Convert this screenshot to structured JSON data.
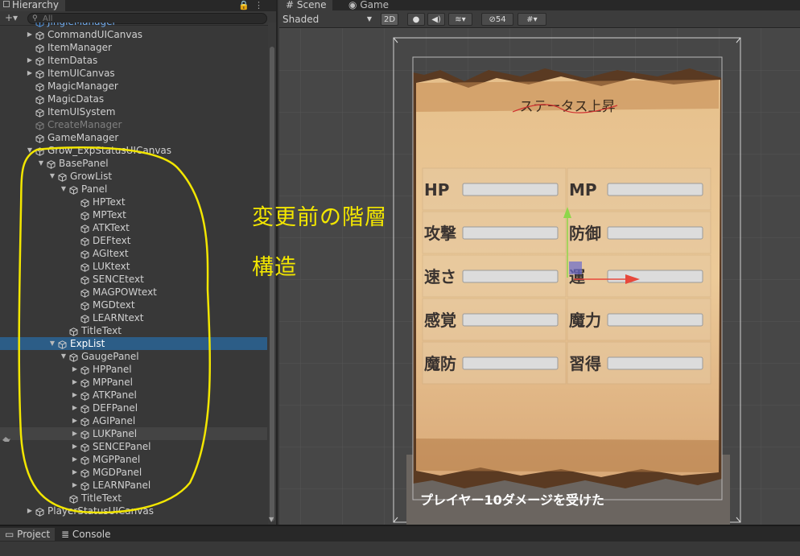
{
  "hierarchy": {
    "tab_label": "Hierarchy",
    "search_placeholder": "All",
    "items": [
      {
        "label": "JingleManager",
        "depth": 0,
        "arrow": "",
        "style": "blue"
      },
      {
        "label": "CommandUICanvas",
        "depth": 0,
        "arrow": "right"
      },
      {
        "label": "ItemManager",
        "depth": 0,
        "arrow": ""
      },
      {
        "label": "ItemDatas",
        "depth": 0,
        "arrow": "right"
      },
      {
        "label": "ItemUICanvas",
        "depth": 0,
        "arrow": "right"
      },
      {
        "label": "MagicManager",
        "depth": 0,
        "arrow": ""
      },
      {
        "label": "MagicDatas",
        "depth": 0,
        "arrow": ""
      },
      {
        "label": "ItemUISystem",
        "depth": 0,
        "arrow": ""
      },
      {
        "label": "CreateManager",
        "depth": 0,
        "arrow": "",
        "style": "dim"
      },
      {
        "label": "GameManager",
        "depth": 0,
        "arrow": ""
      },
      {
        "label": "Grow_ExpStatusUICanvas",
        "depth": 0,
        "arrow": "down"
      },
      {
        "label": "BasePanel",
        "depth": 1,
        "arrow": "down"
      },
      {
        "label": "GrowList",
        "depth": 2,
        "arrow": "down"
      },
      {
        "label": "Panel",
        "depth": 3,
        "arrow": "down"
      },
      {
        "label": "HPText",
        "depth": 4,
        "arrow": ""
      },
      {
        "label": "MPText",
        "depth": 4,
        "arrow": ""
      },
      {
        "label": "ATKText",
        "depth": 4,
        "arrow": ""
      },
      {
        "label": "DEFtext",
        "depth": 4,
        "arrow": ""
      },
      {
        "label": "AGItext",
        "depth": 4,
        "arrow": ""
      },
      {
        "label": "LUKtext",
        "depth": 4,
        "arrow": ""
      },
      {
        "label": "SENCEtext",
        "depth": 4,
        "arrow": ""
      },
      {
        "label": "MAGPOWtext",
        "depth": 4,
        "arrow": ""
      },
      {
        "label": "MGDtext",
        "depth": 4,
        "arrow": ""
      },
      {
        "label": "LEARNtext",
        "depth": 4,
        "arrow": ""
      },
      {
        "label": "TitleText",
        "depth": 3,
        "arrow": ""
      },
      {
        "label": "ExpList",
        "depth": 2,
        "arrow": "down",
        "style": "sel"
      },
      {
        "label": "GaugePanel",
        "depth": 3,
        "arrow": "down"
      },
      {
        "label": "HPPanel",
        "depth": 4,
        "arrow": "right"
      },
      {
        "label": "MPPanel",
        "depth": 4,
        "arrow": "right"
      },
      {
        "label": "ATKPanel",
        "depth": 4,
        "arrow": "right"
      },
      {
        "label": "DEFPanel",
        "depth": 4,
        "arrow": "right"
      },
      {
        "label": "AGIPanel",
        "depth": 4,
        "arrow": "right"
      },
      {
        "label": "LUKPanel",
        "depth": 4,
        "arrow": "right",
        "style": "hov"
      },
      {
        "label": "SENCEPanel",
        "depth": 4,
        "arrow": "right"
      },
      {
        "label": "MGPPanel",
        "depth": 4,
        "arrow": "right"
      },
      {
        "label": "MGDPanel",
        "depth": 4,
        "arrow": "right"
      },
      {
        "label": "LEARNPanel",
        "depth": 4,
        "arrow": "right"
      },
      {
        "label": "TitleText",
        "depth": 3,
        "arrow": ""
      },
      {
        "label": "PlayerStatusUICanvas",
        "depth": 0,
        "arrow": "right"
      }
    ]
  },
  "scene": {
    "tab_scene": "Scene",
    "tab_game": "Game",
    "shading_mode": "Shaded",
    "btn_2d": "2D",
    "hidden_count": "54",
    "panel_title": "ステータス上昇",
    "rows": [
      [
        "HP",
        "MP"
      ],
      [
        "攻撃",
        "防御"
      ],
      [
        "速さ",
        "運"
      ],
      [
        "感覚",
        "魔力"
      ],
      [
        "魔防",
        "習得"
      ]
    ],
    "message": "プレイヤー10ダメージを受けた"
  },
  "annotation": {
    "line1": "変更前の階層",
    "line2": "構造",
    "color": "#f2e600"
  },
  "bottom": {
    "tab_project": "Project",
    "tab_console": "Console"
  },
  "colors": {
    "selection": "#2c5d87",
    "panel_bg": "#383838",
    "scene_bg": "#474747",
    "parchment": "#e7c08f"
  }
}
